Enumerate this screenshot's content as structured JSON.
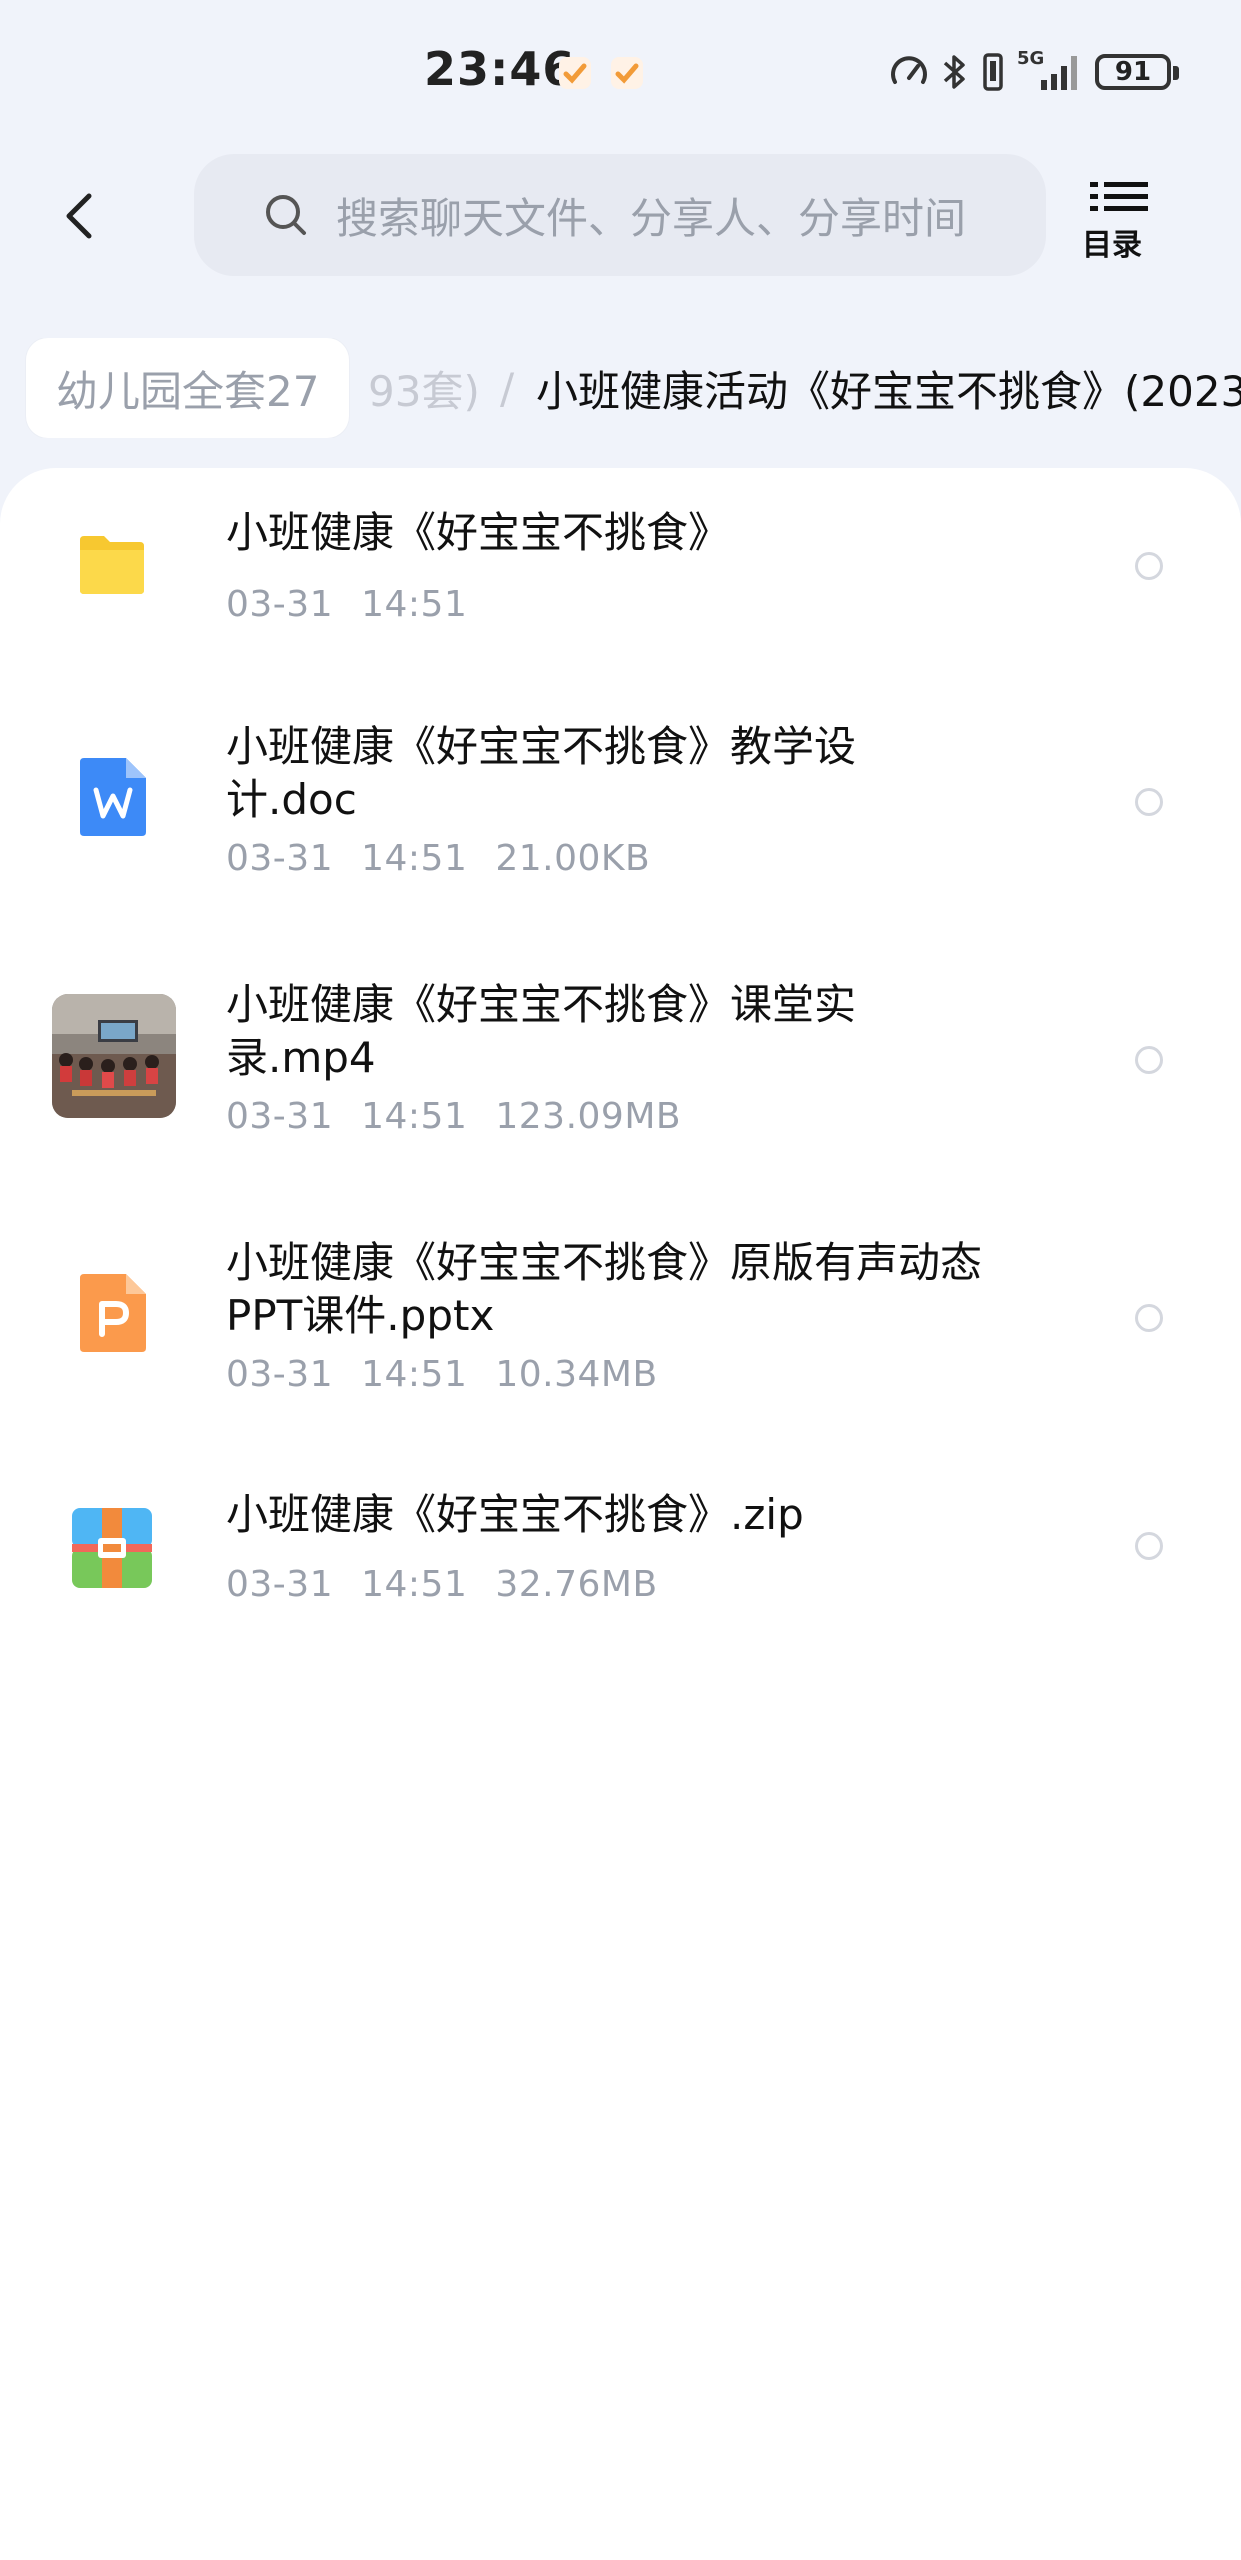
{
  "status_bar": {
    "time": "23:46",
    "network": "5G",
    "battery": "91"
  },
  "header": {
    "search_placeholder": "搜索聊天文件、分享人、分享时间",
    "toc_label": "目录"
  },
  "breadcrumb": {
    "first": "幼儿园全套27",
    "middle": "93套)",
    "separator": "/",
    "current": "小班健康活动《好宝宝不挑食》(2023"
  },
  "files": [
    {
      "name": "小班健康《好宝宝不挑食》",
      "date": "03-31",
      "time": "14:51",
      "size": "",
      "icon": "folder-icon",
      "color": "#fcd94a"
    },
    {
      "name": "小班健康《好宝宝不挑食》教学设计.doc",
      "date": "03-31",
      "time": "14:51",
      "size": "21.00KB",
      "icon": "word-doc-icon",
      "color": "#3d8af7"
    },
    {
      "name": "小班健康《好宝宝不挑食》课堂实录.mp4",
      "date": "03-31",
      "time": "14:51",
      "size": "123.09MB",
      "icon": "video-thumbnail",
      "color": "#7a6f6a"
    },
    {
      "name": "小班健康《好宝宝不挑食》原版有声动态PPT课件.pptx",
      "date": "03-31",
      "time": "14:51",
      "size": "10.34MB",
      "icon": "ppt-icon",
      "color": "#fb9a4c"
    },
    {
      "name": "小班健康《好宝宝不挑食》.zip",
      "date": "03-31",
      "time": "14:51",
      "size": "32.76MB",
      "icon": "zip-icon",
      "color": "#4fb6f4"
    }
  ]
}
